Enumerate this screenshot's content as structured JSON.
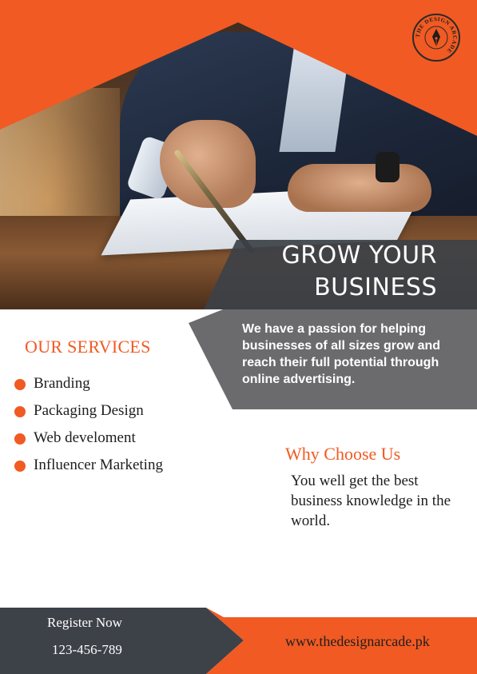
{
  "brand": {
    "logo_text": "THE DESIGN ARCADE",
    "accent_color": "#f15a22",
    "dark_color": "#3d4148",
    "gray_color": "#6b6b6e"
  },
  "headline": {
    "line1": "GROW YOUR",
    "line2": "BUSINESS"
  },
  "intro": {
    "text": "We have a passion for helping businesses of all sizes grow and reach their full potential through online advertising."
  },
  "services": {
    "title": "OUR SERVICES",
    "items": [
      {
        "label": "Branding"
      },
      {
        "label": "Packaging Design"
      },
      {
        "label": "Web develoment"
      },
      {
        "label": "Influencer Marketing"
      }
    ]
  },
  "why": {
    "title": "Why Choose Us",
    "text": "You well get the best business knowledge in the world."
  },
  "footer": {
    "register_label": "Register Now",
    "phone": "123-456-789",
    "website": "www.thedesignarcade.pk"
  }
}
